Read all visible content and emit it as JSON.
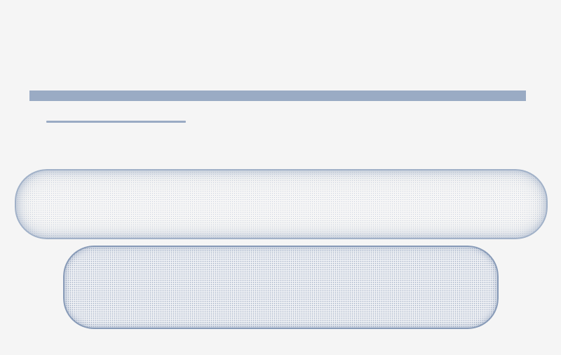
{
  "screen": {
    "title": "",
    "subtitle": "",
    "input": {
      "value": "",
      "placeholder": ""
    },
    "button": {
      "label": ""
    }
  },
  "colors": {
    "background": "#f5f5f5",
    "skeleton": "#9aabc4",
    "stipple": "#788caf"
  }
}
